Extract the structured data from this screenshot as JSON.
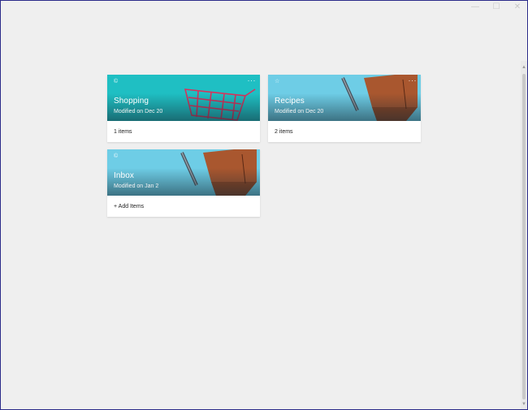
{
  "window": {
    "controls": [
      {
        "name": "minimize",
        "glyph": "—"
      },
      {
        "name": "maximize",
        "glyph": "☐"
      },
      {
        "name": "close",
        "glyph": "✕"
      }
    ]
  },
  "lists": [
    {
      "title": "Shopping",
      "subtitle": "Modified on Dec 20",
      "footer": "1 items",
      "theme": "cart",
      "color": "#1fbfc3"
    },
    {
      "title": "Recipes",
      "subtitle": "Modified on Dec 20",
      "footer": "2 items",
      "theme": "notebook",
      "color": "#6ecde6"
    },
    {
      "title": "Inbox",
      "subtitle": "Modified on Jan 2",
      "footer": "+ Add Items",
      "theme": "notebook",
      "color": "#6ecde6"
    }
  ],
  "icons": {
    "pin": "pin-icon",
    "more": "more-options-icon"
  },
  "scroll": {
    "up_glyph": "▲",
    "down_glyph": "▼"
  }
}
